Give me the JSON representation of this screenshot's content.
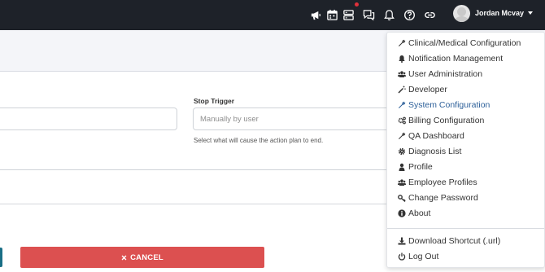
{
  "topbar": {
    "icons": [
      "megaphone-icon",
      "calendar-icon",
      "server-icon",
      "chat-icon",
      "bell-icon",
      "help-icon",
      "link-icon"
    ],
    "username": "Jordan Mcvay"
  },
  "form": {
    "stop_trigger_label": "Stop Trigger",
    "stop_trigger_placeholder": "Manually by user",
    "stop_trigger_help": "Select what will cause the action plan to end."
  },
  "buttons": {
    "cancel_label": "CANCEL"
  },
  "menu": {
    "items": [
      {
        "label": "Clinical/Medical Configuration",
        "icon": "wrench-icon"
      },
      {
        "label": "Notification Management",
        "icon": "bell-icon"
      },
      {
        "label": "User Administration",
        "icon": "users-icon"
      },
      {
        "label": "Developer",
        "icon": "magic-wand-icon"
      },
      {
        "label": "System Configuration",
        "icon": "wrench-icon",
        "active": true
      },
      {
        "label": "Billing Configuration",
        "icon": "gears-icon"
      },
      {
        "label": "QA Dashboard",
        "icon": "wrench-icon"
      },
      {
        "label": "Diagnosis List",
        "icon": "gear-icon"
      },
      {
        "label": "Profile",
        "icon": "user-icon"
      },
      {
        "label": "Employee Profiles",
        "icon": "users-icon"
      },
      {
        "label": "Change Password",
        "icon": "key-icon"
      },
      {
        "label": "About",
        "icon": "info-icon"
      }
    ],
    "footer_items": [
      {
        "label": "Download Shortcut (.url)",
        "icon": "download-icon"
      },
      {
        "label": "Log Out",
        "icon": "power-icon"
      }
    ]
  },
  "colors": {
    "topbar": "#1e2229",
    "cancel": "#dc5050",
    "active_item": "#2c5f99",
    "notification_dot": "#e0313b"
  }
}
